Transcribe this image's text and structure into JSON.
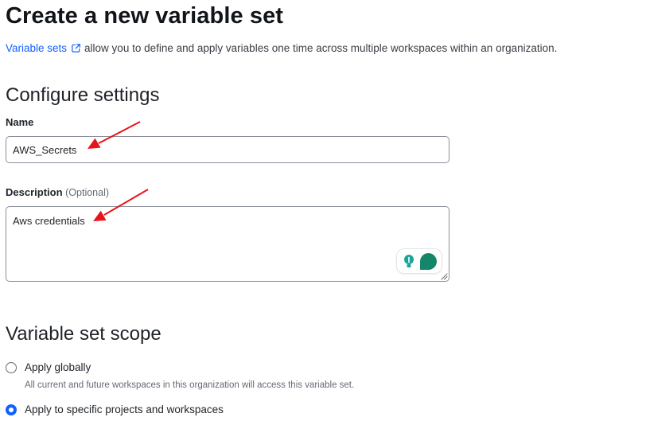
{
  "page": {
    "title": "Create a new variable set",
    "intro_link": "Variable sets",
    "intro_text": "allow you to define and apply variables one time across multiple workspaces within an organization."
  },
  "configure": {
    "title": "Configure settings",
    "name_label": "Name",
    "name_value": "AWS_Secrets",
    "description_label": "Description",
    "description_optional": "(Optional)",
    "description_value": "Aws credentials"
  },
  "scope": {
    "title": "Variable set scope",
    "options": [
      {
        "label": "Apply globally",
        "help": "All current and future workspaces in this organization will access this variable set.",
        "checked": false
      },
      {
        "label": "Apply to specific projects and workspaces",
        "checked": true
      }
    ]
  },
  "icons": {
    "external_link": "external-link-icon",
    "lightbulb": "lightbulb-icon",
    "grammar_assistant": "grammar-assistant-icon",
    "resize": "resize-handle-icon"
  },
  "colors": {
    "link": "#1060ff",
    "radio_checked": "#1060ff",
    "annotation_arrow": "#e8131b",
    "assistant_green": "#14876a"
  }
}
